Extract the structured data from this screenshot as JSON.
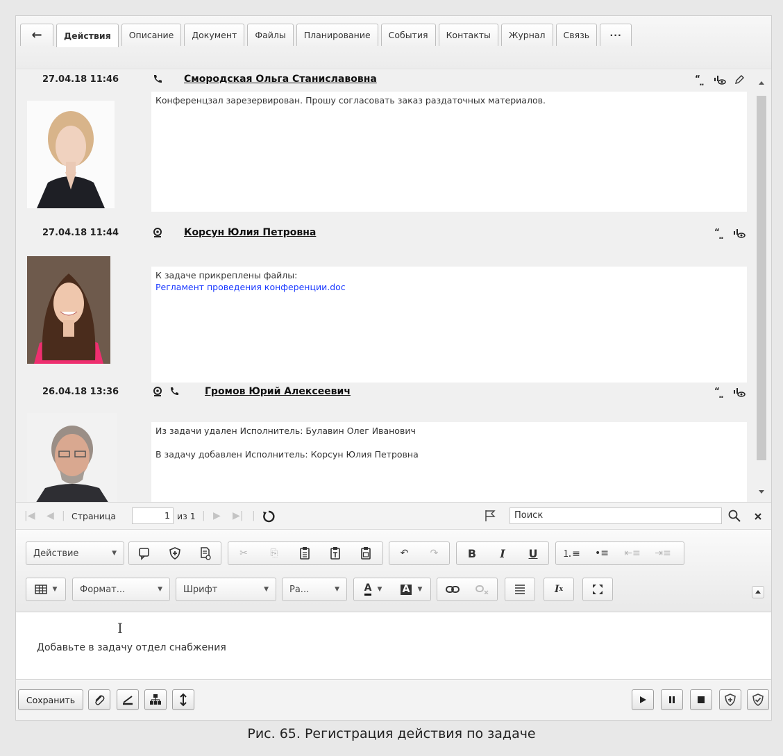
{
  "tabs": {
    "back": "←",
    "items": [
      "Действия",
      "Описание",
      "Документ",
      "Файлы",
      "Планирование",
      "События",
      "Контакты",
      "Журнал",
      "Связь"
    ],
    "more": "···"
  },
  "entries": [
    {
      "date": "27.04.18 11:46",
      "author": "Смородская Ольга Станиславовна",
      "channels": [
        "phone-icon"
      ],
      "actions": [
        "quote-icon",
        "read-status-icon",
        "edit-icon"
      ],
      "lines": [
        "Конференцзал зарезервирован. Прошу согласовать заказ раздаточных материалов."
      ]
    },
    {
      "date": "27.04.18 11:44",
      "author": "Корсун Юлия Петровна",
      "channels": [
        "webcam-icon"
      ],
      "actions": [
        "quote-icon",
        "read-status-icon"
      ],
      "lines": [
        "К задаче прикреплены файлы:"
      ],
      "attachment": "Регламент проведения конференции.doc"
    },
    {
      "date": "26.04.18 13:36",
      "author": "Громов Юрий Алексеевич",
      "channels": [
        "webcam-icon",
        "phone-icon"
      ],
      "actions": [
        "quote-icon",
        "read-status-icon"
      ],
      "lines": [
        "Из задачи удален Исполнитель: Булавин Олег Иванович",
        "В задачу добавлен Исполнитель: Корсун Юлия Петровна"
      ]
    }
  ],
  "pager": {
    "page_label": "Страница",
    "page_value": "1",
    "of_label": "из 1",
    "search_placeholder": "Поиск"
  },
  "toolbar": {
    "action_dropdown": "Действие",
    "format_dropdown": "Формат...",
    "font_dropdown": "Шрифт",
    "size_dropdown": "Ра...",
    "bold": "B",
    "italic": "I",
    "underline": "U"
  },
  "editor": {
    "text": "Добавьте в задачу отдел снабжения"
  },
  "footer": {
    "save_label": "Сохранить"
  },
  "caption": "Рис. 65. Регистрация действия по задаче"
}
